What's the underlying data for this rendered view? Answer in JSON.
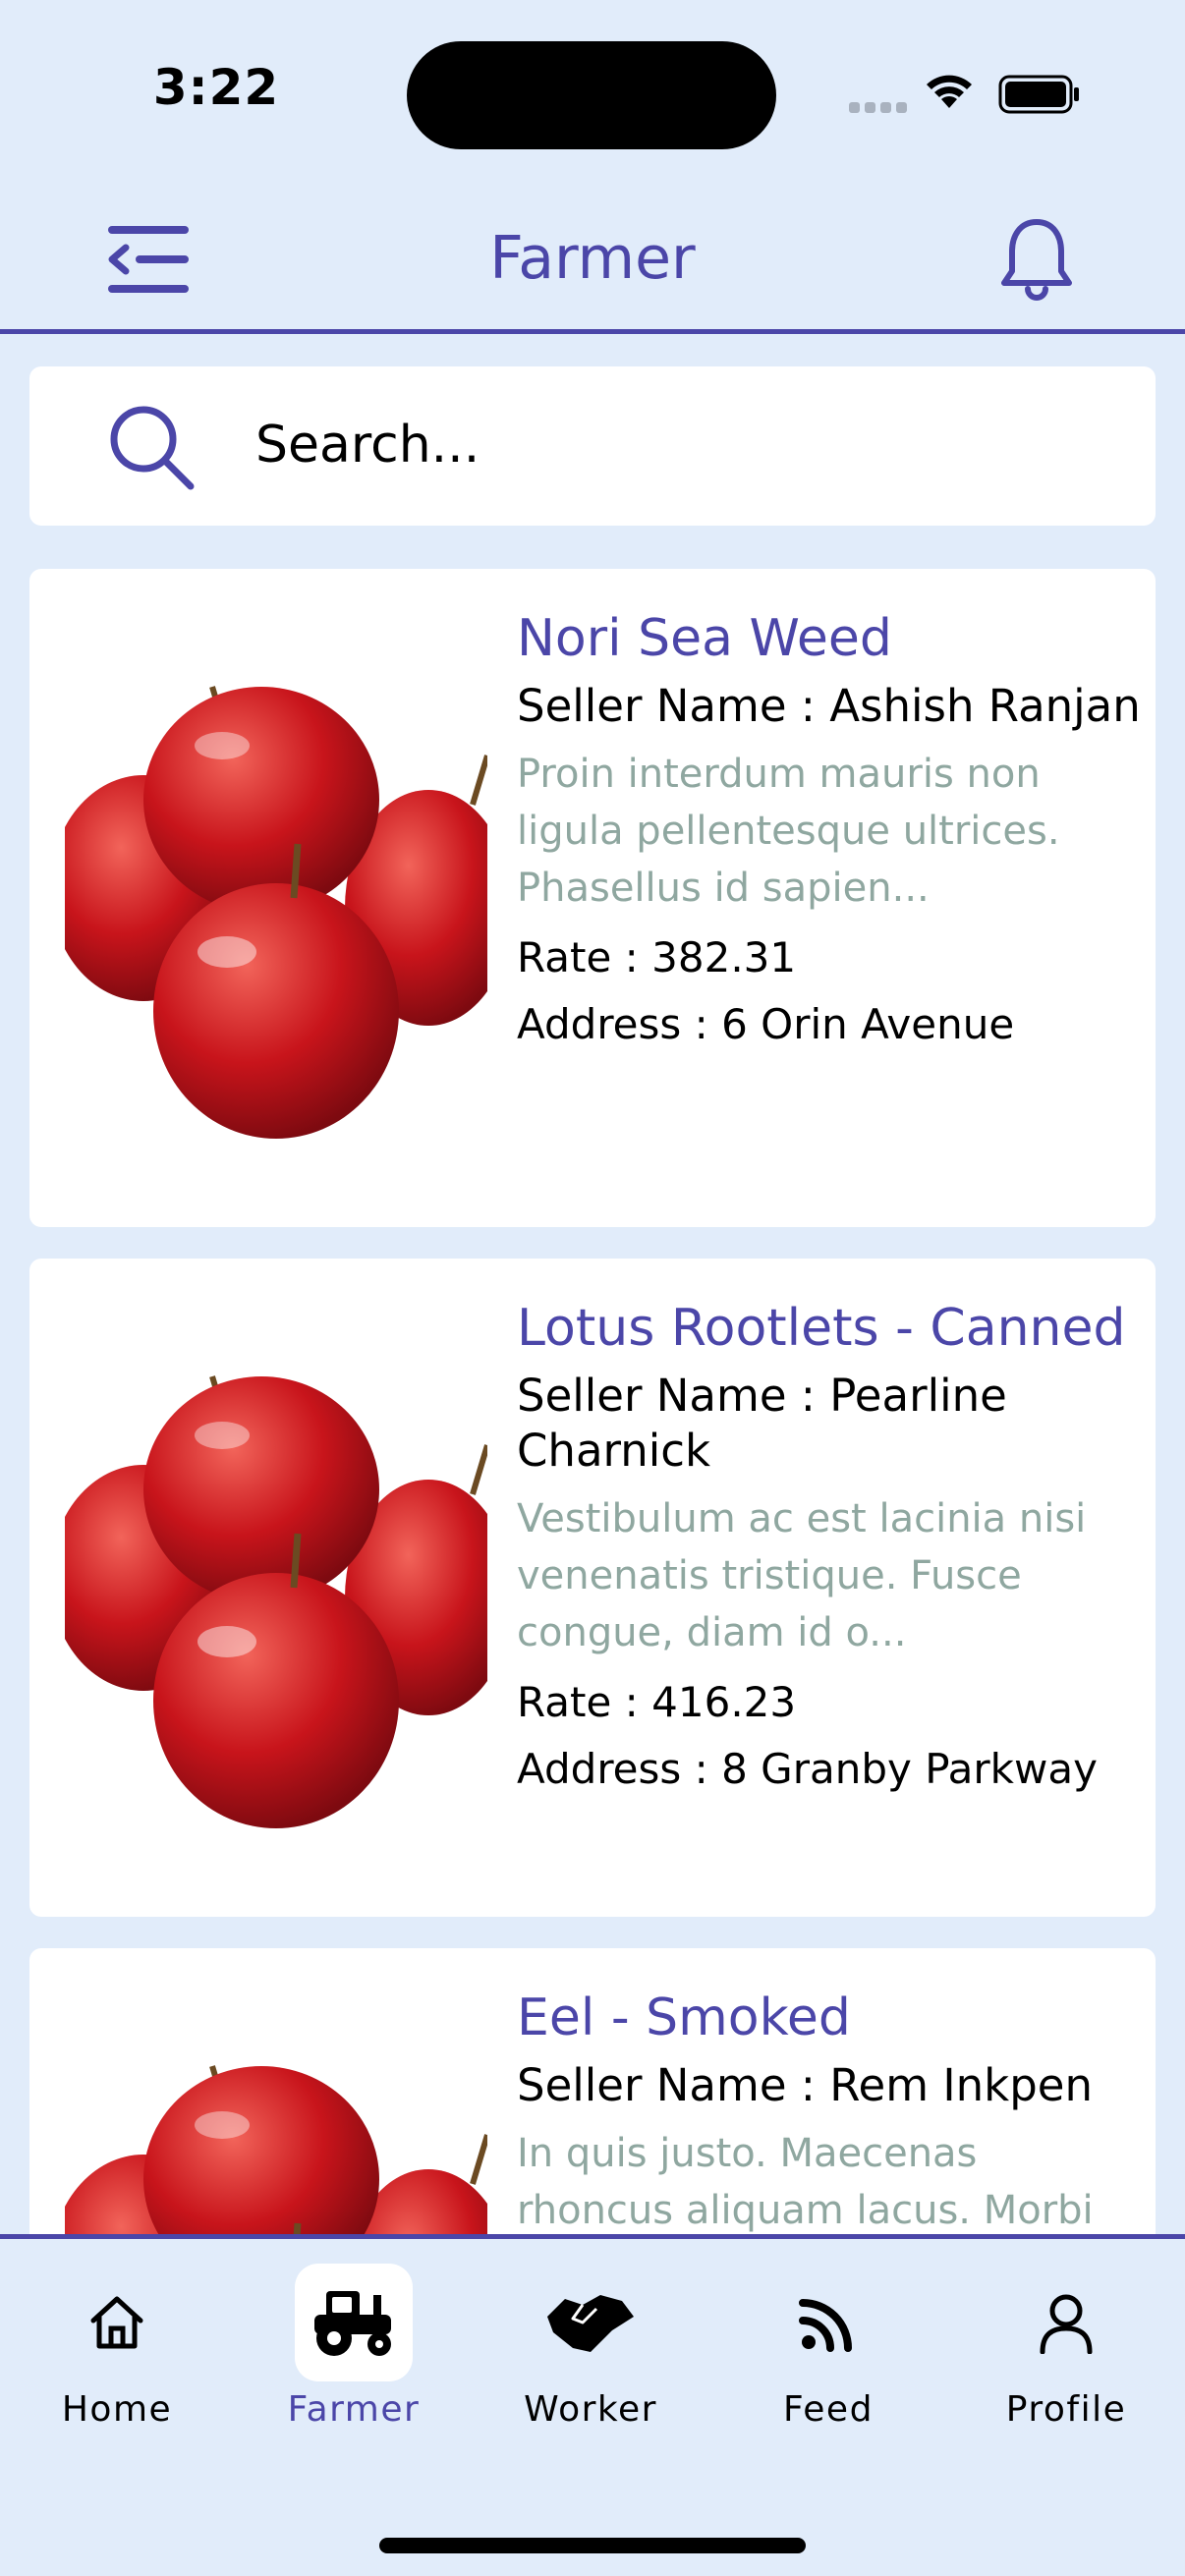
{
  "status_bar": {
    "time": "3:22"
  },
  "header": {
    "title": "Farmer"
  },
  "search": {
    "placeholder": "Search..."
  },
  "products": [
    {
      "title": "Nori Sea Weed",
      "seller": "Seller Name : Ashish Ranjan",
      "description": "Proin interdum mauris non ligula pellentesque ultrices. Phasellus id sapien...",
      "rate": "Rate : 382.31",
      "address": "Address : 6 Orin Avenue"
    },
    {
      "title": "Lotus Rootlets - Canned",
      "seller": "Seller Name : Pearline Charnick",
      "description": "Vestibulum ac est lacinia nisi venenatis tristique. Fusce congue, diam id o...",
      "rate": "Rate : 416.23",
      "address": "Address : 8 Granby Parkway"
    },
    {
      "title": "Eel - Smoked",
      "seller": "Seller Name : Rem Inkpen",
      "description": "In quis justo. Maecenas rhoncus aliquam lacus. Morbi quis tortor",
      "rate": "",
      "address": ""
    }
  ],
  "nav": {
    "items": [
      {
        "label": "Home",
        "icon": "home-icon"
      },
      {
        "label": "Farmer",
        "icon": "tractor-icon",
        "active": true
      },
      {
        "label": "Worker",
        "icon": "handshake-icon"
      },
      {
        "label": "Feed",
        "icon": "rss-feed-icon"
      },
      {
        "label": "Profile",
        "icon": "user-icon"
      }
    ]
  },
  "colors": {
    "background": "#e1ecfa",
    "accent": "#4b46a8",
    "card": "#ffffff",
    "description_text": "#8fa7a0"
  }
}
